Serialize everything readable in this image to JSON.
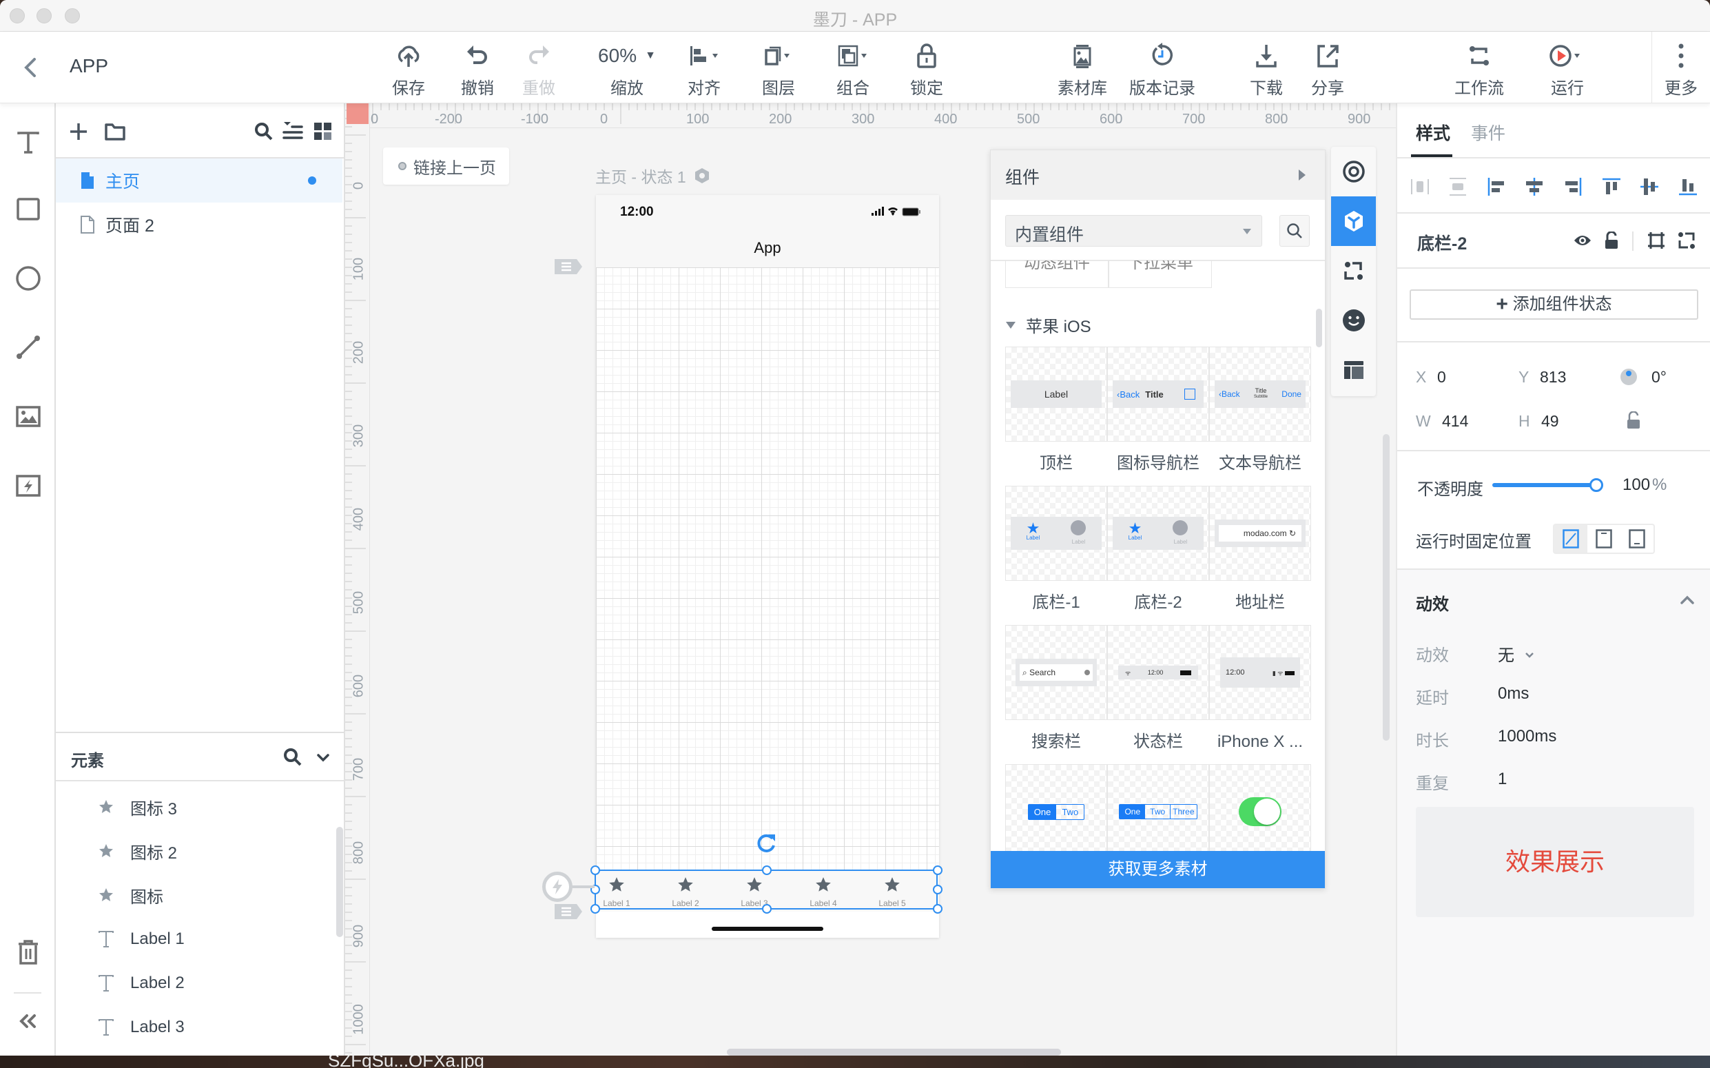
{
  "window": {
    "title": "墨刀 - APP",
    "app_name": "APP"
  },
  "toolbar": {
    "save": "保存",
    "undo": "撤销",
    "redo": "重做",
    "zoom_value": "60%",
    "zoom_label": "缩放",
    "align": "对齐",
    "layer": "图层",
    "group": "组合",
    "lock": "锁定",
    "assets": "素材库",
    "history": "版本记录",
    "download": "下载",
    "share": "分享",
    "workflow": "工作流",
    "run": "运行",
    "more": "更多"
  },
  "pages": {
    "items": [
      {
        "label": "主页",
        "active": true
      },
      {
        "label": "页面 2",
        "active": false
      }
    ]
  },
  "elements": {
    "title": "元素",
    "items": [
      {
        "icon": "star-icon",
        "label": "图标 3"
      },
      {
        "icon": "star-icon",
        "label": "图标 2"
      },
      {
        "icon": "star-icon",
        "label": "图标"
      },
      {
        "icon": "text-icon",
        "label": "Label 1"
      },
      {
        "icon": "text-icon",
        "label": "Label 2"
      },
      {
        "icon": "text-icon",
        "label": "Label 3"
      }
    ]
  },
  "rulers": {
    "top": [
      "0",
      "-200",
      "-100",
      "0",
      "100",
      "200",
      "300",
      "400",
      "500",
      "600",
      "700",
      "800",
      "900"
    ],
    "left": [
      "0",
      "100",
      "200",
      "300",
      "400",
      "500",
      "600",
      "700",
      "800",
      "900",
      "1000"
    ]
  },
  "canvas": {
    "link_prev": "链接上一页",
    "state_label": "主页 - 状态 1",
    "phone": {
      "time": "12:00",
      "title": "App",
      "tabs": [
        "Label 1",
        "Label 2",
        "Label 3",
        "Label 4",
        "Label 5"
      ]
    }
  },
  "components": {
    "title": "组件",
    "source": "内置组件",
    "old_tiles": [
      "动态组件",
      "下拉菜单"
    ],
    "section": "苹果 iOS",
    "tiles": [
      {
        "caption": "顶栏",
        "preview": "Label"
      },
      {
        "caption": "图标导航栏",
        "preview_back": "Back",
        "preview_title": "Title"
      },
      {
        "caption": "文本导航栏",
        "preview_back": "Back",
        "preview_title": "Title",
        "preview_subtitle": "Subtitle",
        "preview_done": "Done"
      },
      {
        "caption": "底栏-1",
        "preview_label": "Label"
      },
      {
        "caption": "底栏-2",
        "preview_label": "Label"
      },
      {
        "caption": "地址栏",
        "preview": "modao.com"
      },
      {
        "caption": "搜索栏",
        "preview": "Search"
      },
      {
        "caption": "状态栏",
        "preview": "12:00"
      },
      {
        "caption": "iPhone X ...",
        "preview": "12:00"
      },
      {
        "caption": "",
        "segments": [
          "One",
          "Two"
        ]
      },
      {
        "caption": "",
        "segments": [
          "One",
          "Two",
          "Three"
        ]
      },
      {
        "caption": "",
        "toggle": true
      }
    ],
    "get_more": "获取更多素材"
  },
  "properties": {
    "tabs": [
      "样式",
      "事件"
    ],
    "active_tab": "样式",
    "component_name": "底栏-2",
    "add_state": "添加组件状态",
    "x_label": "X",
    "x": "0",
    "y_label": "Y",
    "y": "813",
    "rotation": "0°",
    "w_label": "W",
    "w": "414",
    "h_label": "H",
    "h": "49",
    "opacity_label": "不透明度",
    "opacity_value": "100",
    "opacity_unit": "%",
    "opacity_fraction": 1.0,
    "fixed_label": "运行时固定位置",
    "animation": {
      "title": "动效",
      "effect_label": "动效",
      "effect_value": "无",
      "delay_label": "延时",
      "delay_value": "0ms",
      "duration_label": "时长",
      "duration_value": "1000ms",
      "repeat_label": "重复",
      "repeat_value": "1",
      "preview": "效果展示"
    }
  },
  "desktop": {
    "file_label": "SZFqSu...OFXa.jpg"
  },
  "colors": {
    "accent": "#2f8ef0",
    "preview_red": "#e44a3c",
    "toggle_green": "#4cd964"
  }
}
